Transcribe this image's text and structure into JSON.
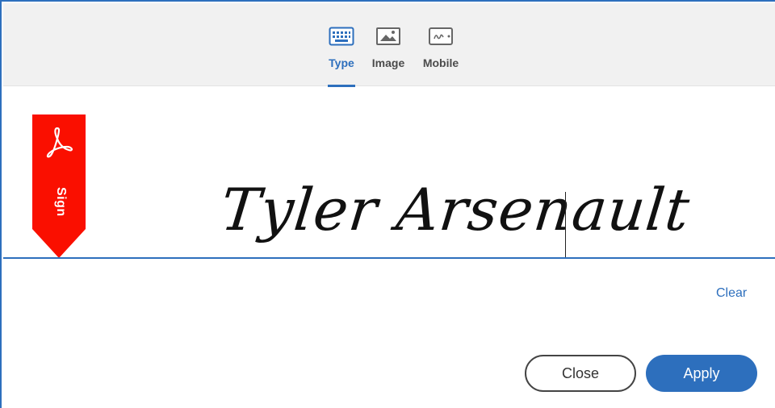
{
  "tabs": [
    {
      "label": "Type",
      "icon": "keyboard-icon",
      "active": true
    },
    {
      "label": "Image",
      "icon": "image-icon",
      "active": false
    },
    {
      "label": "Mobile",
      "icon": "mobile-icon",
      "active": false
    }
  ],
  "ribbon": {
    "label": "Sign",
    "icon": "acrobat-logo-icon",
    "color": "#fa0f00"
  },
  "signature": {
    "value": "Tyler Arsenault"
  },
  "actions": {
    "clear_label": "Clear",
    "close_label": "Close",
    "apply_label": "Apply"
  },
  "colors": {
    "accent": "#2d6fbd",
    "ribbon": "#fa0f00"
  }
}
